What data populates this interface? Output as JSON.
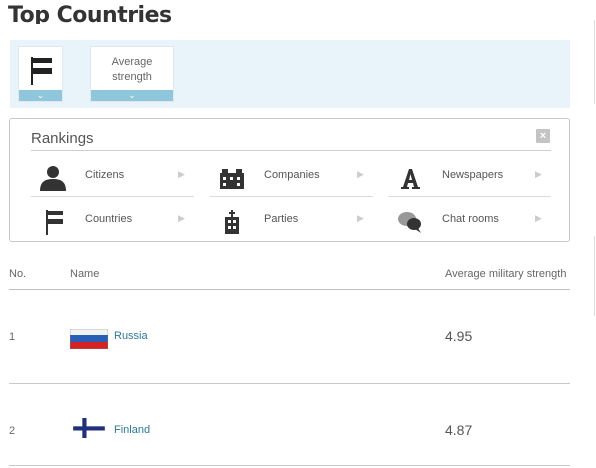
{
  "page": {
    "title": "Top Countries"
  },
  "filters": {
    "country_flag_icon": "flag-icon",
    "metric_label": "Average strength",
    "caret": "⌄"
  },
  "rankings": {
    "title": "Rankings",
    "close": "×",
    "items": [
      {
        "label": "Citizens",
        "icon": "citizen-icon"
      },
      {
        "label": "Companies",
        "icon": "companies-icon"
      },
      {
        "label": "Newspapers",
        "icon": "newspaper-icon"
      },
      {
        "label": "Countries",
        "icon": "flag-icon"
      },
      {
        "label": "Parties",
        "icon": "parties-icon"
      },
      {
        "label": "Chat rooms",
        "icon": "chat-icon"
      }
    ],
    "arrow": "▶"
  },
  "table": {
    "headers": {
      "no": "No.",
      "name": "Name",
      "value": "Average military strength"
    },
    "rows": [
      {
        "rank": "1",
        "name": "Russia",
        "value": "4.95",
        "flag": "russia-flag"
      },
      {
        "rank": "2",
        "name": "Finland",
        "value": "4.87",
        "flag": "finland-flag"
      }
    ]
  },
  "colors": {
    "accent": "#8fc6db",
    "filter_bg": "#e8f4fa",
    "link": "#2a7a9e"
  }
}
